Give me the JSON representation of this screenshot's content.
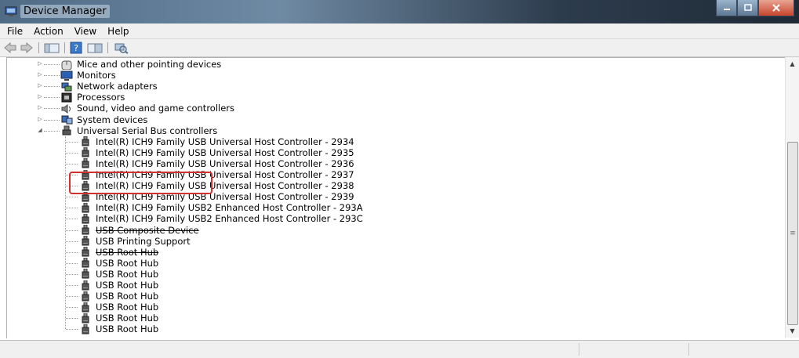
{
  "window": {
    "title": "Device Manager"
  },
  "menu": [
    "File",
    "Action",
    "View",
    "Help"
  ],
  "categories": [
    {
      "label": "Mice and other pointing devices",
      "icon": "mouse-icon",
      "expanded": false
    },
    {
      "label": "Monitors",
      "icon": "monitor-icon",
      "expanded": false
    },
    {
      "label": "Network adapters",
      "icon": "network-adapter-icon",
      "expanded": false
    },
    {
      "label": "Processors",
      "icon": "processor-icon",
      "expanded": false
    },
    {
      "label": "Sound, video and game controllers",
      "icon": "speaker-icon",
      "expanded": false
    },
    {
      "label": "System devices",
      "icon": "system-devices-icon",
      "expanded": false
    },
    {
      "label": "Universal Serial Bus controllers",
      "icon": "usb-icon",
      "expanded": true
    }
  ],
  "usb_devices": [
    "Intel(R) ICH9 Family USB Universal Host Controller - 2934",
    "Intel(R) ICH9 Family USB Universal Host Controller - 2935",
    "Intel(R) ICH9 Family USB Universal Host Controller - 2936",
    "Intel(R) ICH9 Family USB Universal Host Controller - 2937",
    "Intel(R) ICH9 Family USB Universal Host Controller - 2938",
    "Intel(R) ICH9 Family USB Universal Host Controller - 2939",
    "Intel(R) ICH9 Family USB2 Enhanced Host Controller - 293A",
    "Intel(R) ICH9 Family USB2 Enhanced Host Controller - 293C",
    "USB Composite Device",
    "USB Printing Support",
    "USB Root Hub",
    "USB Root Hub",
    "USB Root Hub",
    "USB Root Hub",
    "USB Root Hub",
    "USB Root Hub",
    "USB Root Hub",
    "USB Root Hub"
  ],
  "annotation": {
    "highlighted_item": "USB Printing Support",
    "color": "#d4302d"
  }
}
